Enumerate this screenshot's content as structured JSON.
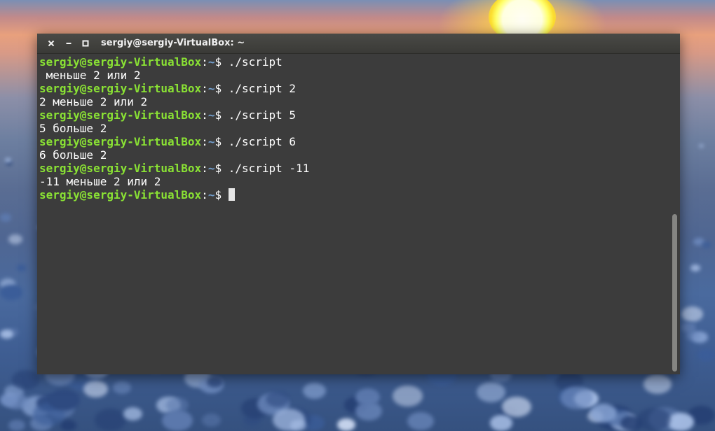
{
  "window": {
    "title": "sergiy@sergiy-VirtualBox: ~",
    "buttons": [
      "close-icon",
      "minimize-icon",
      "maximize-icon"
    ]
  },
  "terminal": {
    "prompt_user": "sergiy@sergiy-VirtualBox",
    "prompt_colon": ":",
    "prompt_path": "~",
    "prompt_dollar": "$ ",
    "lines": [
      {
        "type": "prompt",
        "cmd": "./script"
      },
      {
        "type": "output",
        "text": " меньше 2 или 2"
      },
      {
        "type": "prompt",
        "cmd": "./script 2"
      },
      {
        "type": "output",
        "text": "2 меньше 2 или 2"
      },
      {
        "type": "prompt",
        "cmd": "./script 5"
      },
      {
        "type": "output",
        "text": "5 больше 2"
      },
      {
        "type": "prompt",
        "cmd": "./script 6"
      },
      {
        "type": "output",
        "text": "6 больше 2"
      },
      {
        "type": "prompt",
        "cmd": "./script -11"
      },
      {
        "type": "output",
        "text": "-11 меньше 2 или 2"
      },
      {
        "type": "prompt",
        "cmd": ""
      }
    ]
  },
  "colors": {
    "user": "#8ae234",
    "path": "#729fcf",
    "text": "#ffffff",
    "background": "#3c3c3c"
  },
  "scroll_position": 0.5
}
